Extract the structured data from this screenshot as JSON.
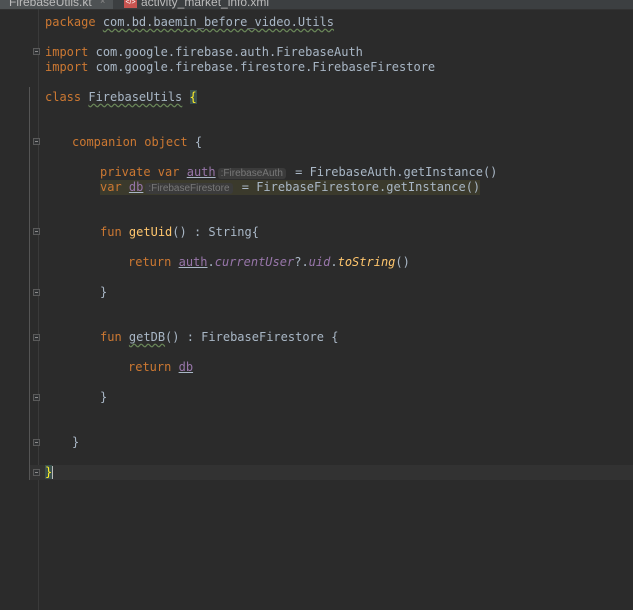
{
  "tabs": [
    {
      "label": "FirebaseUtils.kt",
      "close": "×",
      "active": true
    },
    {
      "label": "activity_market_info.xml",
      "icon": "xml-file-icon",
      "badge": "</>",
      "active": false
    }
  ],
  "code": {
    "package_kw": "package",
    "package_name": "com.bd.baemin_before_video.Utils",
    "import_kw": "import",
    "import1": "com.google.firebase.auth.FirebaseAuth",
    "import2": "com.google.firebase.firestore.FirebaseFirestore",
    "class_kw": "class",
    "class_name": "FirebaseUtils",
    "open_brace": "{",
    "companion": "companion object",
    "companion_brace": " {",
    "private_var": "private var",
    "auth": "auth",
    "auth_hint": ":FirebaseAuth",
    "auth_rhs": " = FirebaseAuth.getInstance()",
    "var_kw": "var",
    "db": "db",
    "db_hint": ":FirebaseFirestore",
    "db_rhs": " = FirebaseFirestore.getInstance()",
    "fun_kw": "fun",
    "getUid": "getUid",
    "getUid_sig": "() : String{",
    "return_kw": "return",
    "currentUser": "currentUser",
    "qdot": "?.",
    "uid": "uid",
    "toString": "toString",
    "parens": "()",
    "close_brace": "}",
    "getDB": "getDB",
    "getDB_sig": "() : FirebaseFirestore {",
    "dot": "."
  }
}
